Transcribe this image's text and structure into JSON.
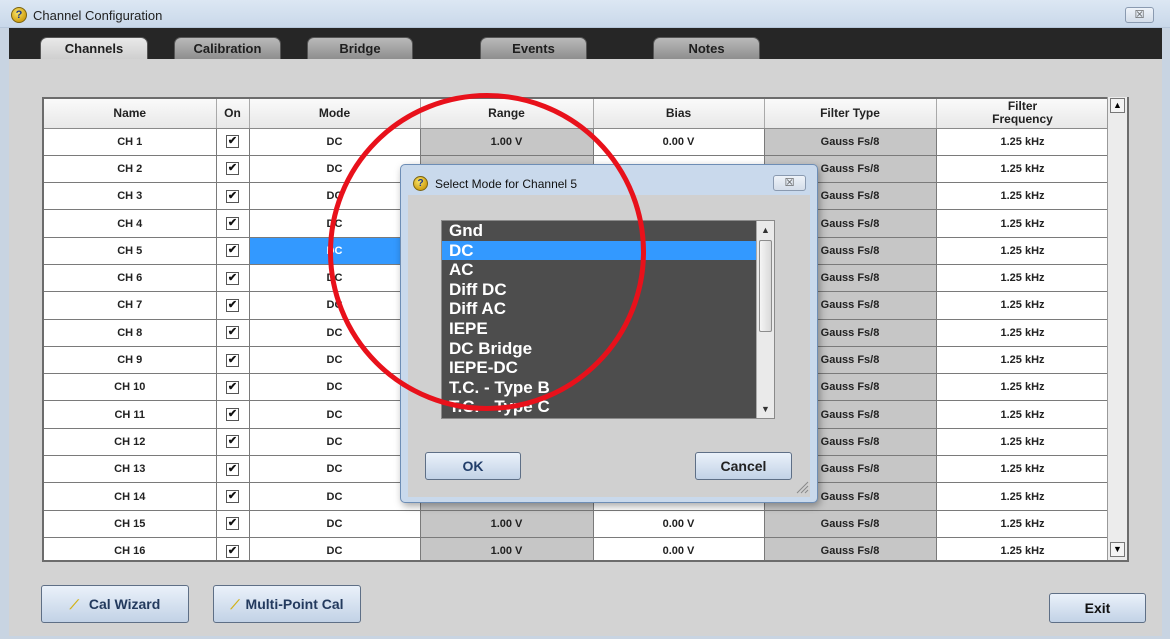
{
  "window": {
    "title": "Channel Configuration",
    "close_glyph": "☒"
  },
  "tabs": [
    {
      "label": "Channels",
      "active": true
    },
    {
      "label": "Calibration",
      "active": false
    },
    {
      "label": "Bridge",
      "active": false
    },
    {
      "label": "Events",
      "active": false
    },
    {
      "label": "Notes",
      "active": false
    }
  ],
  "table": {
    "headers": [
      "Name",
      "On",
      "Mode",
      "Range",
      "Bias",
      "Filter Type",
      "Filter\nFrequency"
    ],
    "rows": [
      {
        "name": "CH 1",
        "on": true,
        "mode": "DC",
        "range": "1.00  V",
        "bias": "0.00  V",
        "filter_type": "Gauss Fs/8",
        "filter_frequency": "1.25 kHz"
      },
      {
        "name": "CH 2",
        "on": true,
        "mode": "DC",
        "range": "",
        "bias": "",
        "filter_type": "Gauss Fs/8",
        "filter_frequency": "1.25 kHz"
      },
      {
        "name": "CH 3",
        "on": true,
        "mode": "DC",
        "range": "",
        "bias": "",
        "filter_type": "Gauss Fs/8",
        "filter_frequency": "1.25 kHz"
      },
      {
        "name": "CH 4",
        "on": true,
        "mode": "DC",
        "range": "",
        "bias": "",
        "filter_type": "Gauss Fs/8",
        "filter_frequency": "1.25 kHz"
      },
      {
        "name": "CH 5",
        "on": true,
        "mode": "DC",
        "range": "",
        "bias": "",
        "filter_type": "Gauss Fs/8",
        "filter_frequency": "1.25 kHz",
        "selected": true
      },
      {
        "name": "CH 6",
        "on": true,
        "mode": "DC",
        "range": "",
        "bias": "",
        "filter_type": "Gauss Fs/8",
        "filter_frequency": "1.25 kHz"
      },
      {
        "name": "CH 7",
        "on": true,
        "mode": "DC",
        "range": "",
        "bias": "",
        "filter_type": "Gauss Fs/8",
        "filter_frequency": "1.25 kHz"
      },
      {
        "name": "CH 8",
        "on": true,
        "mode": "DC",
        "range": "",
        "bias": "",
        "filter_type": "Gauss Fs/8",
        "filter_frequency": "1.25 kHz"
      },
      {
        "name": "CH 9",
        "on": true,
        "mode": "DC",
        "range": "",
        "bias": "",
        "filter_type": "Gauss Fs/8",
        "filter_frequency": "1.25 kHz"
      },
      {
        "name": "CH 10",
        "on": true,
        "mode": "DC",
        "range": "",
        "bias": "",
        "filter_type": "Gauss Fs/8",
        "filter_frequency": "1.25 kHz"
      },
      {
        "name": "CH 11",
        "on": true,
        "mode": "DC",
        "range": "",
        "bias": "",
        "filter_type": "Gauss Fs/8",
        "filter_frequency": "1.25 kHz"
      },
      {
        "name": "CH 12",
        "on": true,
        "mode": "DC",
        "range": "",
        "bias": "",
        "filter_type": "Gauss Fs/8",
        "filter_frequency": "1.25 kHz"
      },
      {
        "name": "CH 13",
        "on": true,
        "mode": "DC",
        "range": "",
        "bias": "",
        "filter_type": "Gauss Fs/8",
        "filter_frequency": "1.25 kHz"
      },
      {
        "name": "CH 14",
        "on": true,
        "mode": "DC",
        "range": "",
        "bias": "",
        "filter_type": "Gauss Fs/8",
        "filter_frequency": "1.25 kHz"
      },
      {
        "name": "CH 15",
        "on": true,
        "mode": "DC",
        "range": "1.00  V",
        "bias": "0.00  V",
        "filter_type": "Gauss Fs/8",
        "filter_frequency": "1.25 kHz"
      },
      {
        "name": "CH 16",
        "on": true,
        "mode": "DC",
        "range": "1.00  V",
        "bias": "0.00  V",
        "filter_type": "Gauss Fs/8",
        "filter_frequency": "1.25 kHz"
      }
    ]
  },
  "scrollbar": {
    "up_glyph": "▲",
    "down_glyph": "▼"
  },
  "buttons": {
    "cal_wizard": "Cal Wizard",
    "multi_point_cal": "Multi-Point Cal",
    "exit": "Exit"
  },
  "dialog": {
    "title": "Select Mode for Channel 5",
    "close_glyph": "☒",
    "options": [
      "Gnd",
      "DC",
      "AC",
      "Diff DC",
      "Diff AC",
      "IEPE",
      "DC Bridge",
      "IEPE-DC",
      "T.C. - Type B",
      "T.C. - Type C"
    ],
    "selected_option": "DC",
    "ok_label": "OK",
    "cancel_label": "Cancel"
  },
  "colors": {
    "selection": "#3399ff",
    "annotation_circle": "#e8111b",
    "listbox_background": "#4d4d4d",
    "tab_strip": "#262626"
  }
}
